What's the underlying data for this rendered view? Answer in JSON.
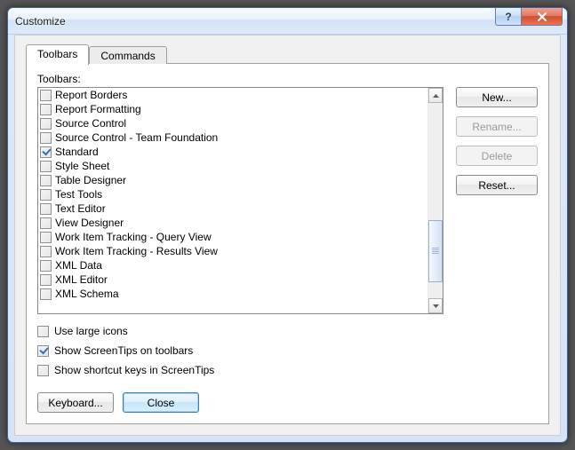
{
  "window": {
    "title": "Customize"
  },
  "tabs": {
    "toolbars": "Toolbars",
    "commands": "Commands"
  },
  "listLabel": "Toolbars:",
  "toolbarItems": [
    {
      "label": "Report Borders",
      "checked": false
    },
    {
      "label": "Report Formatting",
      "checked": false
    },
    {
      "label": "Source Control",
      "checked": false
    },
    {
      "label": "Source Control - Team Foundation",
      "checked": false
    },
    {
      "label": "Standard",
      "checked": true
    },
    {
      "label": "Style Sheet",
      "checked": false
    },
    {
      "label": "Table Designer",
      "checked": false
    },
    {
      "label": "Test Tools",
      "checked": false
    },
    {
      "label": "Text Editor",
      "checked": false
    },
    {
      "label": "View Designer",
      "checked": false
    },
    {
      "label": "Work Item Tracking - Query View",
      "checked": false
    },
    {
      "label": "Work Item Tracking - Results View",
      "checked": false
    },
    {
      "label": "XML Data",
      "checked": false
    },
    {
      "label": "XML Editor",
      "checked": false
    },
    {
      "label": "XML Schema",
      "checked": false
    }
  ],
  "sideButtons": {
    "new": "New...",
    "rename": "Rename...",
    "delete": "Delete",
    "reset": "Reset..."
  },
  "options": [
    {
      "label": "Use large icons",
      "checked": false
    },
    {
      "label": "Show ScreenTips on toolbars",
      "checked": true
    },
    {
      "label": "Show shortcut keys in ScreenTips",
      "checked": false
    }
  ],
  "bottomButtons": {
    "keyboard": "Keyboard...",
    "close": "Close"
  },
  "scrollbar": {
    "thumbTop": 132,
    "thumbHeight": 70
  }
}
